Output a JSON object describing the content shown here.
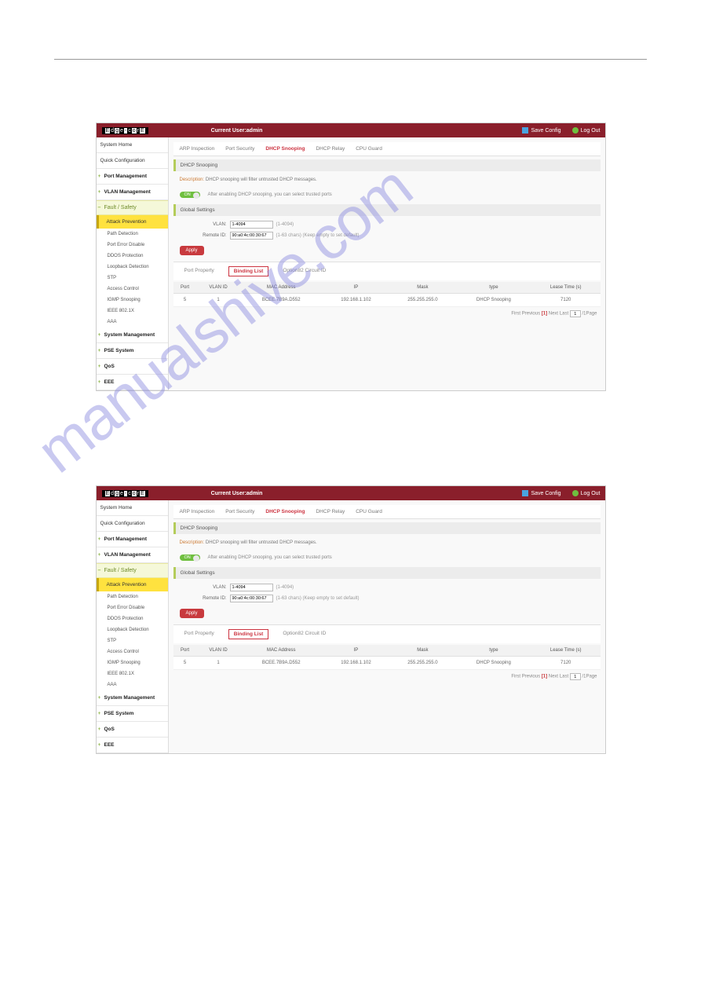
{
  "watermark": "manualshive.com",
  "topbar": {
    "logo_segments": [
      "E",
      "d",
      "g",
      "e",
      "-",
      "c",
      "o",
      "r",
      "E"
    ],
    "current_user_label": "Current User:",
    "current_user": "admin",
    "save_config": "Save Config",
    "logout": "Log Out"
  },
  "sidebar": {
    "system_home": "System Home",
    "quick_config": "Quick Configuration",
    "port_mgmt": "Port Management",
    "vlan_mgmt": "VLAN Management",
    "fault_safety": "Fault / Safety",
    "attack_prevention": "Attack Prevention",
    "subs": [
      "Path Detection",
      "Port Error Disable",
      "DDOS Protection",
      "Loopback Detection",
      "STP",
      "Access Control",
      "IGMP Snooping",
      "IEEE 802.1X",
      "AAA"
    ],
    "sys_mgmt": "System Management",
    "pse": "PSE System",
    "qos": "QoS",
    "eee": "EEE"
  },
  "main": {
    "tabs": [
      "ARP Inspection",
      "Port Security",
      "DHCP Snooping",
      "DHCP Relay",
      "CPU Guard"
    ],
    "active_tab_index": 2,
    "section1": "DHCP Snooping",
    "desc_label": "Description:",
    "desc_text": "DHCP snooping will filter untrusted DHCP messages.",
    "switch_label": "ON",
    "switch_text": "After enabling DHCP snooping, you can select trusted ports",
    "section2": "Global Settings",
    "vlan_label": "VLAN:",
    "vlan_value": "1-4094",
    "vlan_hint": "(1-4094)",
    "remote_label": "Remote ID:",
    "remote_value": "90:a0:4c:00:30:67",
    "remote_hint": "(1-63 chars) (Keep empty to set default)",
    "apply": "Apply",
    "subtabs": [
      "Port Property",
      "Binding List",
      "Option82 Circuit ID"
    ],
    "active_subtab_index": 1,
    "table": {
      "headers": [
        "Port",
        "VLAN ID",
        "MAC Address",
        "IP",
        "Mask",
        "type",
        "Lease Time (s)"
      ],
      "rows": [
        {
          "port": "5",
          "vlan": "1",
          "mac": "BCEE.7B9A.D552",
          "ip": "192.168.1.102",
          "mask": "255.255.255.0",
          "type": "DHCP Snooping",
          "lease": "7120"
        }
      ]
    },
    "pager": {
      "first": "First",
      "prev": "Previous",
      "cur": "[1]",
      "next": "Next",
      "last": "Last",
      "page_input": "1",
      "page_suffix": "/1Page"
    }
  }
}
